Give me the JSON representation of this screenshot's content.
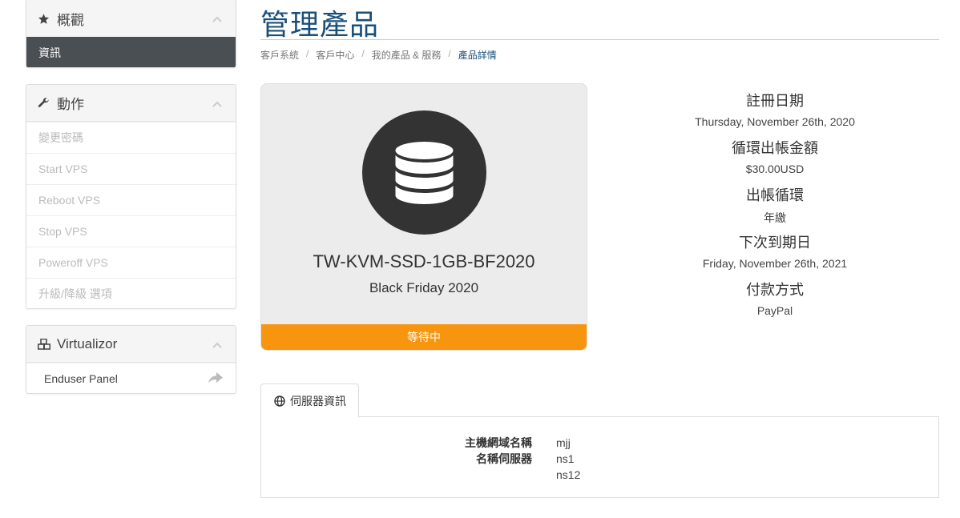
{
  "sidebar": {
    "overview": {
      "title": "概觀",
      "items": [
        {
          "label": "資訊"
        }
      ]
    },
    "actions": {
      "title": "動作",
      "items": [
        {
          "label": "變更密碼"
        },
        {
          "label": "Start VPS"
        },
        {
          "label": "Reboot VPS"
        },
        {
          "label": "Stop VPS"
        },
        {
          "label": "Poweroff VPS"
        },
        {
          "label": "升級/降級 選項"
        }
      ]
    },
    "virtualizor": {
      "title": "Virtualizor",
      "items": [
        {
          "label": "Enduser Panel"
        }
      ]
    }
  },
  "header": {
    "title": "管理產品",
    "breadcrumb": [
      "客戶系統",
      "客戶中心",
      "我的產品 & 服務",
      "產品詳情"
    ]
  },
  "product": {
    "name": "TW-KVM-SSD-1GB-BF2020",
    "group": "Black Friday 2020",
    "status": "等待中",
    "status_color": "#f7960e"
  },
  "details": [
    {
      "label": "註冊日期",
      "value": "Thursday, November 26th, 2020"
    },
    {
      "label": "循環出帳金額",
      "value": "$30.00USD"
    },
    {
      "label": "出帳循環",
      "value": "年繳"
    },
    {
      "label": "下次到期日",
      "value": "Friday, November 26th, 2021"
    },
    {
      "label": "付款方式",
      "value": "PayPal"
    }
  ],
  "server_info": {
    "tab_label": "伺服器資訊",
    "hostname_label": "主機網域名稱",
    "nameservers_label": "名稱伺服器",
    "hostname": "mjj",
    "ns1": "ns1",
    "ns2": "ns12"
  },
  "colors": {
    "title": "#1a4f7a",
    "active_item": "#4a4f54"
  }
}
